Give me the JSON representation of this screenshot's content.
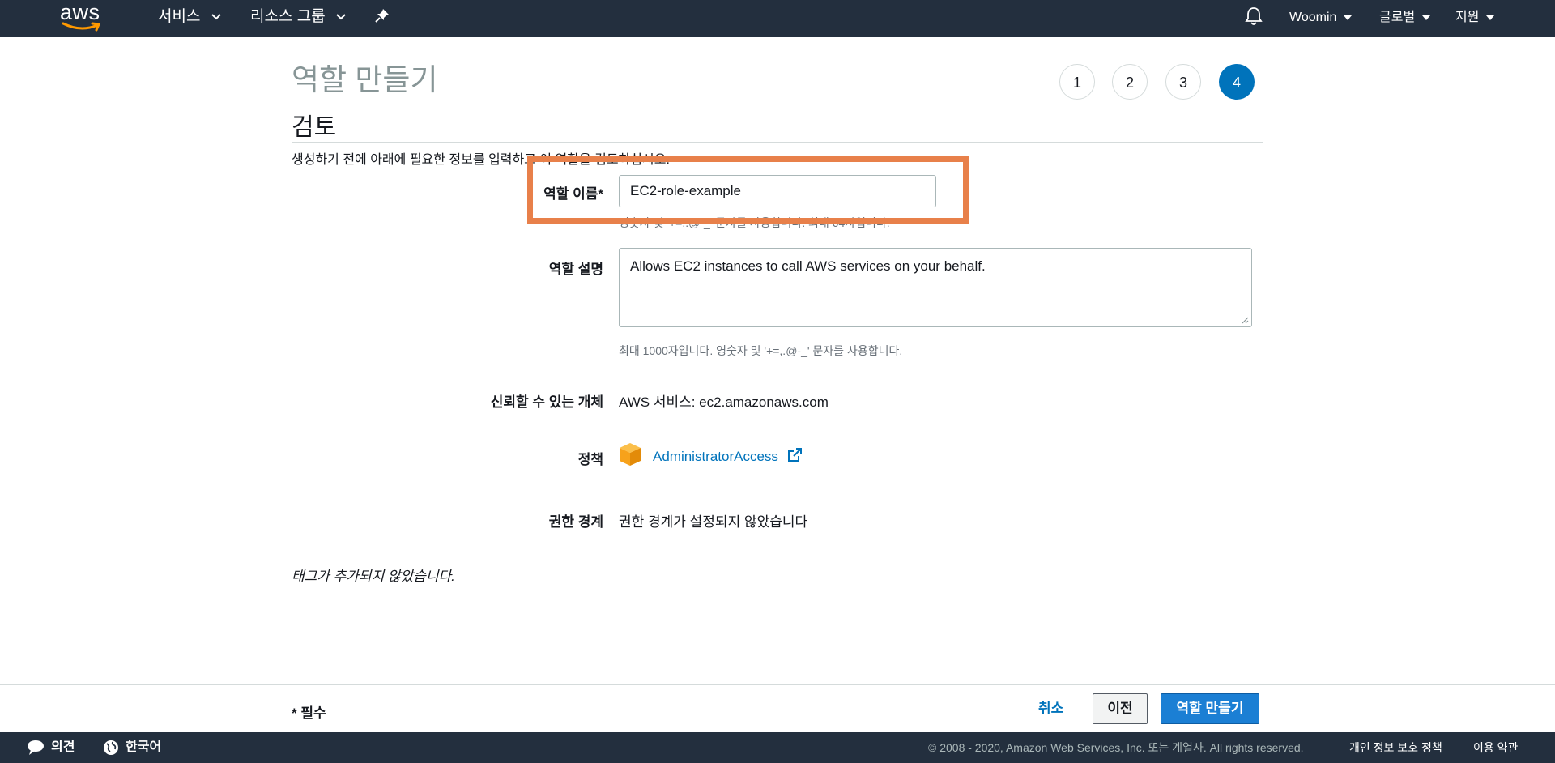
{
  "nav": {
    "logo_text": "aws",
    "services": "서비스",
    "resource_groups": "리소스 그룹",
    "user": "Woomin",
    "region": "글로벌",
    "support": "지원"
  },
  "header": {
    "title": "역할 만들기",
    "steps": [
      "1",
      "2",
      "3",
      "4"
    ],
    "active_step": "4"
  },
  "review": {
    "section_title": "검토",
    "intro": "생성하기 전에 아래에 필요한 정보를 입력하고 이 역할을 검토하십시오."
  },
  "form": {
    "role_name_label": "역할 이름*",
    "role_name_value": "EC2-role-example",
    "role_name_hint": "영숫자 및 '+=,.@-_' 문자를 사용합니다. 최대 64자입니다.",
    "description_label": "역할 설명",
    "description_value": "Allows EC2 instances to call AWS services on your behalf.",
    "description_hint": "최대 1000자입니다. 영숫자 및 '+=,.@-_' 문자를 사용합니다.",
    "trusted_label": "신뢰할 수 있는 개체",
    "trusted_value": "AWS 서비스: ec2.amazonaws.com",
    "policy_label": "정책",
    "policy_value": "AdministratorAccess",
    "boundary_label": "권한 경계",
    "boundary_value": "권한 경계가 설정되지 않았습니다",
    "tags_note": "태그가 추가되지 않았습니다."
  },
  "actions": {
    "required": "* 필수",
    "cancel": "취소",
    "previous": "이전",
    "create": "역할 만들기"
  },
  "footer": {
    "feedback": "의견",
    "language": "한국어",
    "copyright": "© 2008 - 2020, Amazon Web Services, Inc. 또는 계열사. All rights reserved.",
    "privacy": "개인 정보 보호 정책",
    "terms": "이용 약관"
  },
  "colors": {
    "nav_bg": "#232f3e",
    "accent": "#0073bb",
    "highlight": "#e8804a",
    "primary_button": "#1b7fd4",
    "policy_icon": "#f7a21b"
  }
}
